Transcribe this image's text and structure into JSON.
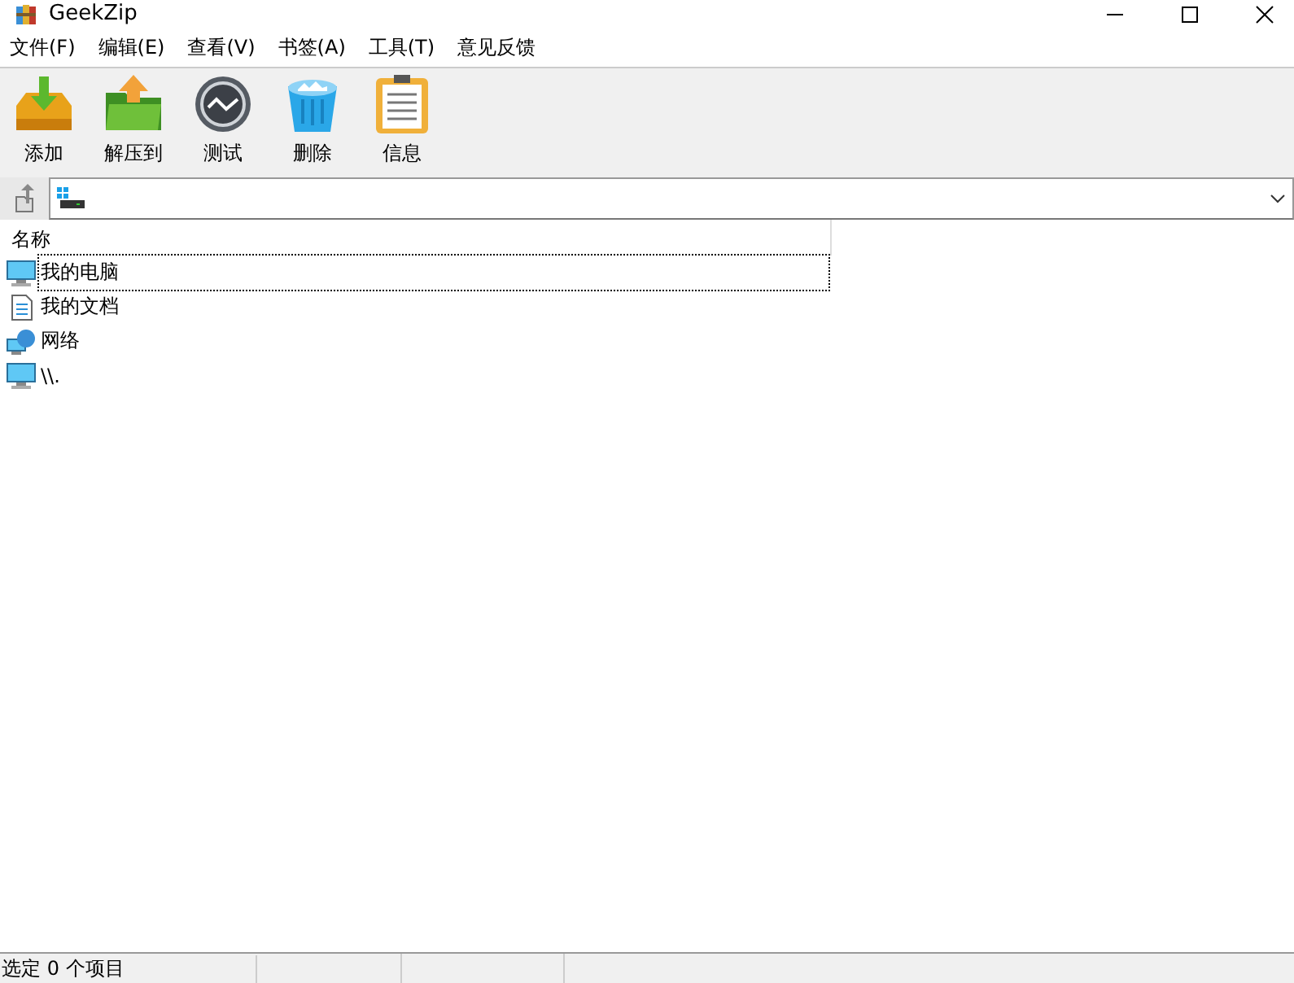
{
  "window": {
    "title": "GeekZip"
  },
  "menu": [
    "文件(F)",
    "编辑(E)",
    "查看(V)",
    "书签(A)",
    "工具(T)",
    "意见反馈"
  ],
  "toolbar": [
    {
      "kind": "add",
      "label": "添加"
    },
    {
      "kind": "extract",
      "label": "解压到"
    },
    {
      "kind": "test",
      "label": "测试"
    },
    {
      "kind": "delete",
      "label": "删除"
    },
    {
      "kind": "info",
      "label": "信息"
    }
  ],
  "table": {
    "columns": [
      "名称"
    ],
    "rows": [
      {
        "kind": "computer",
        "name": "我的电脑",
        "selected": true
      },
      {
        "kind": "document",
        "name": "我的文档",
        "selected": false
      },
      {
        "kind": "network",
        "name": "网络",
        "selected": false
      },
      {
        "kind": "computer",
        "name": "\\\\.",
        "selected": false
      }
    ]
  },
  "status_bar": [
    "选定 0 个项目"
  ]
}
